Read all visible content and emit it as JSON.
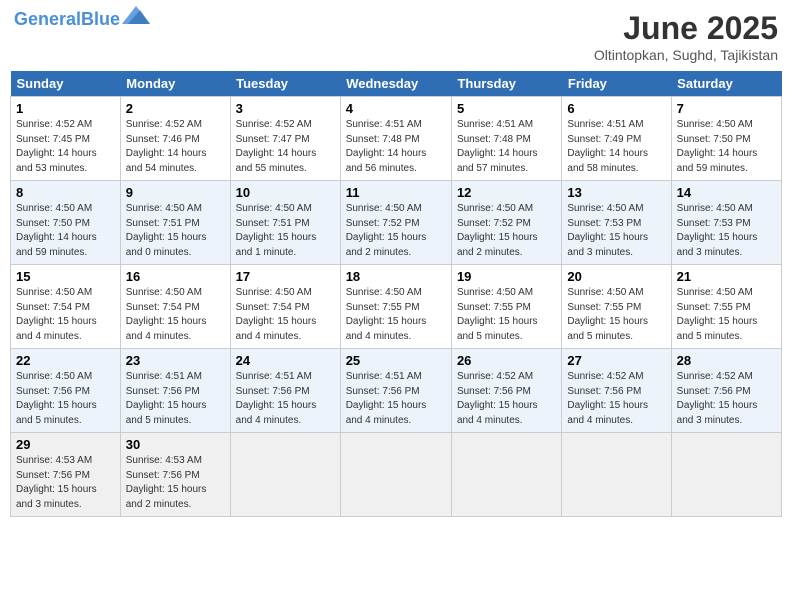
{
  "header": {
    "logo_line1": "General",
    "logo_line2": "Blue",
    "month_title": "June 2025",
    "location": "Oltintopkan, Sughd, Tajikistan"
  },
  "days_of_week": [
    "Sunday",
    "Monday",
    "Tuesday",
    "Wednesday",
    "Thursday",
    "Friday",
    "Saturday"
  ],
  "weeks": [
    [
      {
        "day": "1",
        "info": "Sunrise: 4:52 AM\nSunset: 7:45 PM\nDaylight: 14 hours\nand 53 minutes."
      },
      {
        "day": "2",
        "info": "Sunrise: 4:52 AM\nSunset: 7:46 PM\nDaylight: 14 hours\nand 54 minutes."
      },
      {
        "day": "3",
        "info": "Sunrise: 4:52 AM\nSunset: 7:47 PM\nDaylight: 14 hours\nand 55 minutes."
      },
      {
        "day": "4",
        "info": "Sunrise: 4:51 AM\nSunset: 7:48 PM\nDaylight: 14 hours\nand 56 minutes."
      },
      {
        "day": "5",
        "info": "Sunrise: 4:51 AM\nSunset: 7:48 PM\nDaylight: 14 hours\nand 57 minutes."
      },
      {
        "day": "6",
        "info": "Sunrise: 4:51 AM\nSunset: 7:49 PM\nDaylight: 14 hours\nand 58 minutes."
      },
      {
        "day": "7",
        "info": "Sunrise: 4:50 AM\nSunset: 7:50 PM\nDaylight: 14 hours\nand 59 minutes."
      }
    ],
    [
      {
        "day": "8",
        "info": "Sunrise: 4:50 AM\nSunset: 7:50 PM\nDaylight: 14 hours\nand 59 minutes."
      },
      {
        "day": "9",
        "info": "Sunrise: 4:50 AM\nSunset: 7:51 PM\nDaylight: 15 hours\nand 0 minutes."
      },
      {
        "day": "10",
        "info": "Sunrise: 4:50 AM\nSunset: 7:51 PM\nDaylight: 15 hours\nand 1 minute."
      },
      {
        "day": "11",
        "info": "Sunrise: 4:50 AM\nSunset: 7:52 PM\nDaylight: 15 hours\nand 2 minutes."
      },
      {
        "day": "12",
        "info": "Sunrise: 4:50 AM\nSunset: 7:52 PM\nDaylight: 15 hours\nand 2 minutes."
      },
      {
        "day": "13",
        "info": "Sunrise: 4:50 AM\nSunset: 7:53 PM\nDaylight: 15 hours\nand 3 minutes."
      },
      {
        "day": "14",
        "info": "Sunrise: 4:50 AM\nSunset: 7:53 PM\nDaylight: 15 hours\nand 3 minutes."
      }
    ],
    [
      {
        "day": "15",
        "info": "Sunrise: 4:50 AM\nSunset: 7:54 PM\nDaylight: 15 hours\nand 4 minutes."
      },
      {
        "day": "16",
        "info": "Sunrise: 4:50 AM\nSunset: 7:54 PM\nDaylight: 15 hours\nand 4 minutes."
      },
      {
        "day": "17",
        "info": "Sunrise: 4:50 AM\nSunset: 7:54 PM\nDaylight: 15 hours\nand 4 minutes."
      },
      {
        "day": "18",
        "info": "Sunrise: 4:50 AM\nSunset: 7:55 PM\nDaylight: 15 hours\nand 4 minutes."
      },
      {
        "day": "19",
        "info": "Sunrise: 4:50 AM\nSunset: 7:55 PM\nDaylight: 15 hours\nand 5 minutes."
      },
      {
        "day": "20",
        "info": "Sunrise: 4:50 AM\nSunset: 7:55 PM\nDaylight: 15 hours\nand 5 minutes."
      },
      {
        "day": "21",
        "info": "Sunrise: 4:50 AM\nSunset: 7:55 PM\nDaylight: 15 hours\nand 5 minutes."
      }
    ],
    [
      {
        "day": "22",
        "info": "Sunrise: 4:50 AM\nSunset: 7:56 PM\nDaylight: 15 hours\nand 5 minutes."
      },
      {
        "day": "23",
        "info": "Sunrise: 4:51 AM\nSunset: 7:56 PM\nDaylight: 15 hours\nand 5 minutes."
      },
      {
        "day": "24",
        "info": "Sunrise: 4:51 AM\nSunset: 7:56 PM\nDaylight: 15 hours\nand 4 minutes."
      },
      {
        "day": "25",
        "info": "Sunrise: 4:51 AM\nSunset: 7:56 PM\nDaylight: 15 hours\nand 4 minutes."
      },
      {
        "day": "26",
        "info": "Sunrise: 4:52 AM\nSunset: 7:56 PM\nDaylight: 15 hours\nand 4 minutes."
      },
      {
        "day": "27",
        "info": "Sunrise: 4:52 AM\nSunset: 7:56 PM\nDaylight: 15 hours\nand 4 minutes."
      },
      {
        "day": "28",
        "info": "Sunrise: 4:52 AM\nSunset: 7:56 PM\nDaylight: 15 hours\nand 3 minutes."
      }
    ],
    [
      {
        "day": "29",
        "info": "Sunrise: 4:53 AM\nSunset: 7:56 PM\nDaylight: 15 hours\nand 3 minutes."
      },
      {
        "day": "30",
        "info": "Sunrise: 4:53 AM\nSunset: 7:56 PM\nDaylight: 15 hours\nand 2 minutes."
      },
      {
        "day": "",
        "info": ""
      },
      {
        "day": "",
        "info": ""
      },
      {
        "day": "",
        "info": ""
      },
      {
        "day": "",
        "info": ""
      },
      {
        "day": "",
        "info": ""
      }
    ]
  ]
}
